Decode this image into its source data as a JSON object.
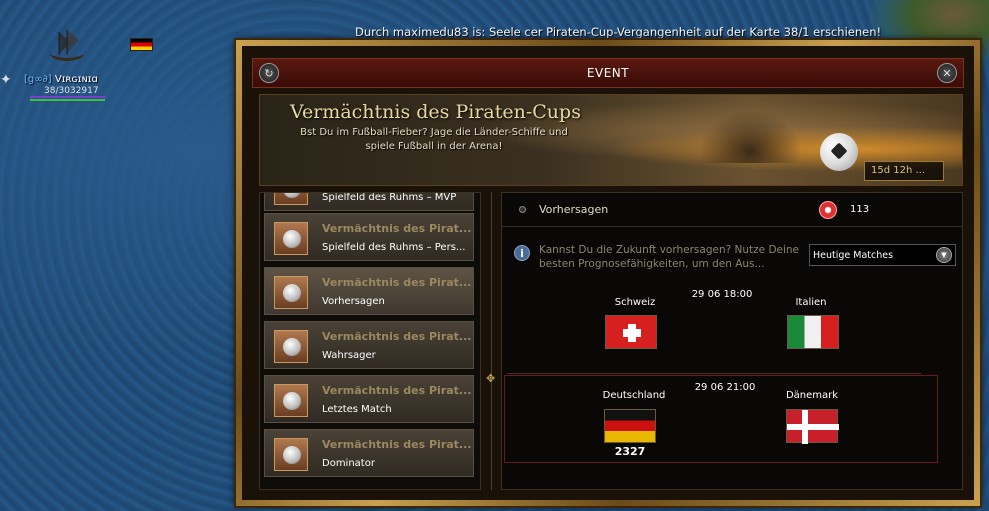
{
  "world": {
    "announcement": "Durch maximedu83 is: Seele cer Piraten-Cup-Vergangenheit auf der Karte 38/1 erschienen!",
    "player": {
      "guild": "[g∞∂]",
      "name": "Vɪʀɢɪɴɪɑ",
      "hp": "38/3032917"
    }
  },
  "event": {
    "title": "EVENT",
    "banner": {
      "title": "Vermächtnis des Piraten-Cups",
      "description": "Bst Du im Fußball-Fieber? Jage die Länder-Schiffe und spiele Fußball in der Arena!",
      "timer": "15d 12h ..."
    },
    "list": [
      {
        "title": "",
        "subtitle": "Spielfeld des Ruhms – MVP"
      },
      {
        "title": "Vermächtnis des Pirat...",
        "subtitle": "Spielfeld des Ruhms – Pers..."
      },
      {
        "title": "Vermächtnis des Pirat...",
        "subtitle": "Vorhersagen"
      },
      {
        "title": "Vermächtnis des Pirat...",
        "subtitle": "Wahrsager"
      },
      {
        "title": "Vermächtnis des Pirat...",
        "subtitle": "Letztes Match"
      },
      {
        "title": "Vermächtnis des Pirat...",
        "subtitle": "Dominator"
      }
    ],
    "selected_index": 2,
    "detail": {
      "header_label": "Vorhersagen",
      "coin_count": "113",
      "info_text": "Kannst Du die Zukunft vorhersagen? Nutze Deine besten Prognosefähigkeiten, um den Aus...",
      "dropdown_selected": "Heutige Matches",
      "matches": [
        {
          "time": "29 06 18:00",
          "home": "Schweiz",
          "away": "Italien",
          "home_flag": "flag-switzerland",
          "away_flag": "flag-italy",
          "home_score": ""
        },
        {
          "time": "29 06 21:00",
          "home": "Deutschland",
          "away": "Dänemark",
          "home_flag": "flag-germany",
          "away_flag": "flag-denmark",
          "home_score": "2327"
        }
      ]
    }
  },
  "colors": {
    "sea": "#1e4a76",
    "window_frame": "#c8a050",
    "titlebar": "#5a1810",
    "list_title": "#9a8860",
    "match_border": "#6a1818"
  },
  "icons": [
    "refresh-icon",
    "close-icon",
    "info-icon",
    "dropdown-arrow-icon",
    "coin-icon",
    "football-icon",
    "scroll-knob-icon"
  ]
}
